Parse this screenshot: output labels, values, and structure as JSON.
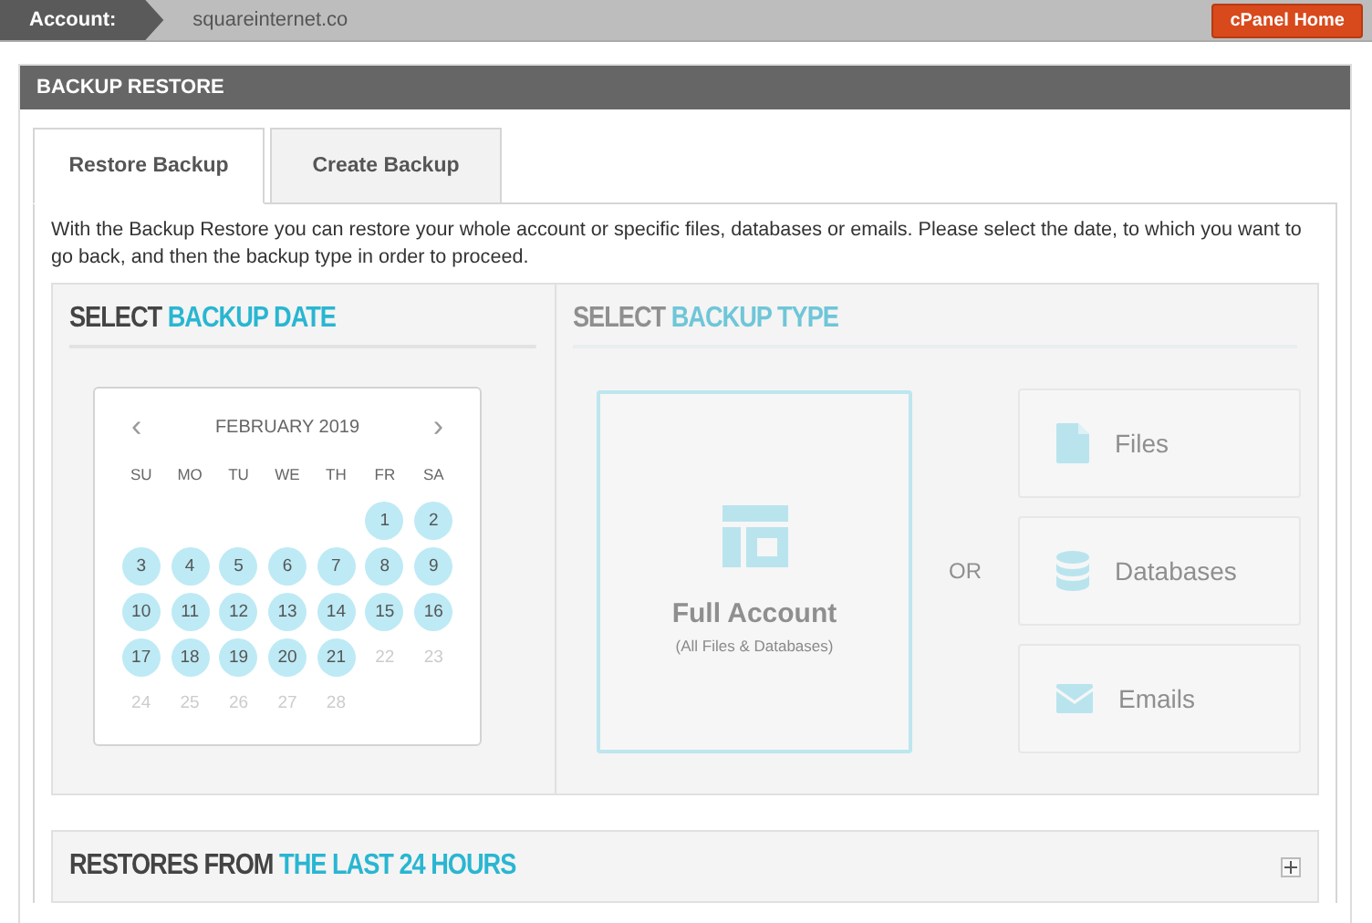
{
  "top_bar": {
    "account_label": "Account:",
    "account_value": "squareinternet.co",
    "home_button": "cPanel Home"
  },
  "panel": {
    "title": "BACKUP RESTORE"
  },
  "tabs": [
    {
      "label": "Restore Backup",
      "selected": true
    },
    {
      "label": "Create Backup",
      "selected": false
    }
  ],
  "description": "With the Backup Restore you can restore your whole account or specific files, databases or emails. Please select the date, to which you want to go back, and then the backup type in order to proceed.",
  "date_section": {
    "heading_lead": "SELECT",
    "heading_accent": "BACKUP DATE",
    "calendar": {
      "month": "FEBRUARY 2019",
      "prev": "‹",
      "next": "›",
      "weekdays": [
        "SU",
        "MO",
        "TU",
        "WE",
        "TH",
        "FR",
        "SA"
      ],
      "weeks": [
        {
          "days": [
            {
              "kind": "blank"
            },
            {
              "kind": "blank"
            },
            {
              "kind": "blank"
            },
            {
              "kind": "blank"
            },
            {
              "kind": "blank"
            },
            {
              "kind": "day",
              "day": "1",
              "available": true
            },
            {
              "kind": "day",
              "day": "2",
              "available": true
            }
          ]
        },
        {
          "days": [
            {
              "day": "3",
              "available": true
            },
            {
              "day": "4",
              "available": true
            },
            {
              "day": "5",
              "available": true
            },
            {
              "day": "6",
              "available": true
            },
            {
              "day": "7",
              "available": true
            },
            {
              "day": "8",
              "available": true
            },
            {
              "day": "9",
              "available": true
            }
          ]
        },
        {
          "days": [
            {
              "day": "10",
              "available": true
            },
            {
              "day": "11",
              "available": true
            },
            {
              "day": "12",
              "available": true
            },
            {
              "day": "13",
              "available": true
            },
            {
              "day": "14",
              "available": true
            },
            {
              "day": "15",
              "available": true
            },
            {
              "day": "16",
              "available": true
            }
          ]
        },
        {
          "days": [
            {
              "day": "17",
              "available": true
            },
            {
              "day": "18",
              "available": true
            },
            {
              "day": "19",
              "available": true
            },
            {
              "day": "20",
              "available": true
            },
            {
              "day": "21",
              "available": true
            },
            {
              "day": "22",
              "available": false
            },
            {
              "day": "23",
              "available": false
            }
          ]
        },
        {
          "days": [
            {
              "day": "24",
              "available": false
            },
            {
              "day": "25",
              "available": false
            },
            {
              "day": "26",
              "available": false
            },
            {
              "day": "27",
              "available": false
            },
            {
              "day": "28",
              "available": false
            }
          ]
        }
      ]
    }
  },
  "type_section": {
    "heading_lead": "SELECT",
    "heading_accent": "BACKUP TYPE",
    "disabled": true,
    "full_account": {
      "title": "Full Account",
      "subtitle": "(All Files & Databases)"
    },
    "separator": "OR",
    "options": [
      {
        "kind": "files",
        "label": "Files"
      },
      {
        "kind": "databases",
        "label": "Databases"
      },
      {
        "kind": "emails",
        "label": "Emails"
      }
    ]
  },
  "recent_section": {
    "heading_lead": "RESTORES FROM",
    "heading_accent": "THE LAST 24 HOURS",
    "expanded": false
  }
}
